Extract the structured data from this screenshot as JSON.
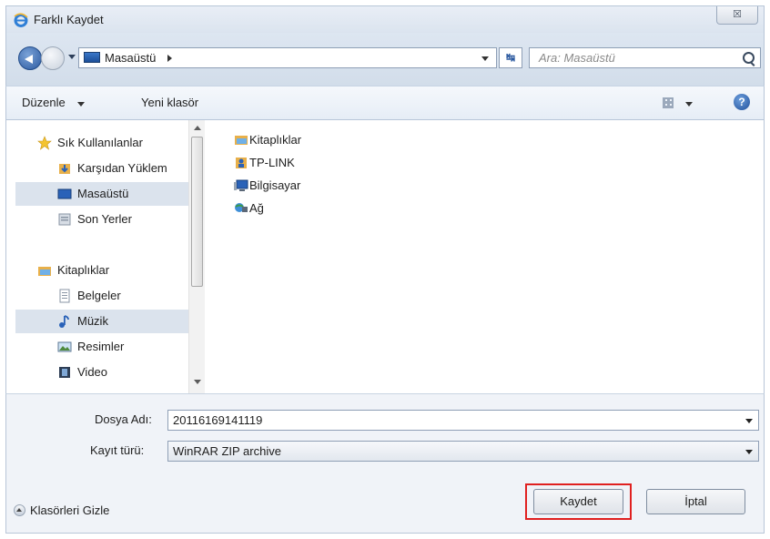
{
  "window": {
    "title": "Farklı Kaydet",
    "close_label": "☒"
  },
  "address": {
    "path_label": "Masaüstü",
    "search_placeholder": "Ara: Masaüstü"
  },
  "toolbar": {
    "organize_label": "Düzenle",
    "new_folder_label": "Yeni klasör",
    "help_label": "?"
  },
  "nav_pane": {
    "items": [
      {
        "label": "Sık Kullanılanlar",
        "icon": "star-icon"
      },
      {
        "label": "Karşıdan Yüklem",
        "icon": "downloads-folder-icon"
      },
      {
        "label": "Masaüstü",
        "icon": "desktop-icon",
        "selected": true
      },
      {
        "label": "Son Yerler",
        "icon": "recent-places-icon"
      },
      {
        "label": "Kitaplıklar",
        "icon": "libraries-icon"
      },
      {
        "label": "Belgeler",
        "icon": "documents-icon"
      },
      {
        "label": "Müzik",
        "icon": "music-icon",
        "selected": true
      },
      {
        "label": "Resimler",
        "icon": "pictures-icon"
      },
      {
        "label": "Video",
        "icon": "video-icon"
      }
    ]
  },
  "files": [
    {
      "label": "Kitaplıklar",
      "icon": "libraries-icon"
    },
    {
      "label": "TP-LINK",
      "icon": "user-folder-icon"
    },
    {
      "label": "Bilgisayar",
      "icon": "computer-icon"
    },
    {
      "label": "Ağ",
      "icon": "network-icon"
    }
  ],
  "form": {
    "filename_label": "Dosya Adı:",
    "filename_value": "20116169141119",
    "filetype_label": "Kayıt türü:",
    "filetype_value": "WinRAR ZIP archive"
  },
  "footer": {
    "hide_folders_label": "Klasörleri Gizle",
    "save_label": "Kaydet",
    "cancel_label": "İptal"
  },
  "colors": {
    "highlight": "#e02020",
    "accent": "#2c5aa0"
  }
}
